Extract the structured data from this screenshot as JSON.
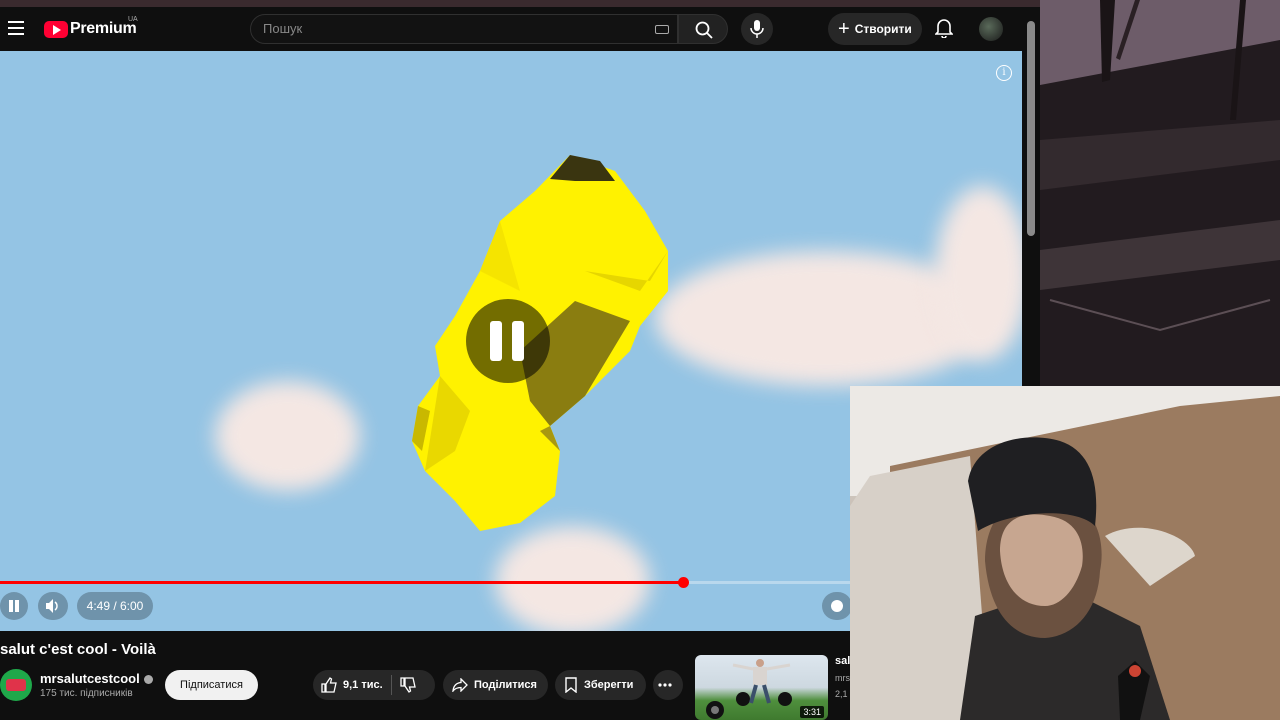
{
  "masthead": {
    "logo_text": "Premium",
    "region": "UA",
    "search_placeholder": "Пошук",
    "create_label": "Створити"
  },
  "player": {
    "time": "4:49 / 6:00",
    "progress": 0.803,
    "state": "paused"
  },
  "video": {
    "title": "salut c'est cool - Voilà",
    "channel": "mrsalutcestcool",
    "subscribers": "175 тис. підписників",
    "subscribe_label": "Підписатися",
    "likes": "9,1 тис.",
    "share_label": "Поділитися",
    "save_label": "Зберегти"
  },
  "recommendation": {
    "title": "sal",
    "meta1": "mrs",
    "meta2": "2,1",
    "duration": "3:31"
  },
  "colors": {
    "brand": "#ff0033",
    "progress": "#ff0000",
    "sky": "#94c4e4",
    "object": "#ffee00"
  }
}
